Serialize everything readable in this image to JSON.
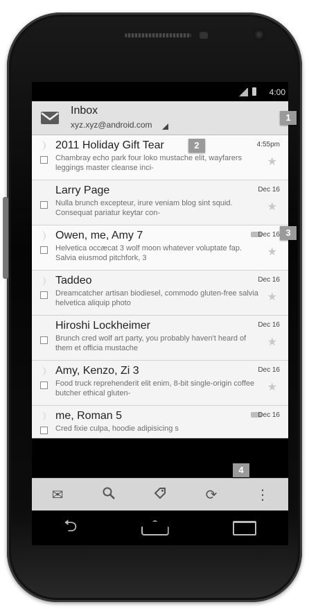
{
  "status_bar": {
    "time": "4:00"
  },
  "header": {
    "title": "Inbox",
    "account": "xyz.xyz@android.com"
  },
  "emails": [
    {
      "sender": "2011 Holiday Gift Tear",
      "date": "4:55pm",
      "snippet": "Chambray echo park four loko mustache elit, wayfarers leggings master cleanse inci-"
    },
    {
      "sender": "Larry Page",
      "date": "Dec 16",
      "snippet": "Nulla brunch excepteur, irure veniam blog sint squid. Consequat pariatur keytar con-"
    },
    {
      "sender": "Owen, me, Amy  7",
      "date": "Dec 16",
      "snippet": "Helvetica occæcat 3 wolf moon whatever voluptate fap. Salvia eiusmod pitchfork, 3"
    },
    {
      "sender": "Taddeo",
      "date": "Dec 16",
      "snippet": "Dreamcatcher artisan biodiesel, commodo gluten-free salvia helvetica aliquip photo"
    },
    {
      "sender": "Hiroshi Lockheimer",
      "date": "Dec 16",
      "snippet": "Brunch cred wolf art party, you probably haven't heard of them et officia mustache"
    },
    {
      "sender": "Amy, Kenzo, Zi  3",
      "date": "Dec 16",
      "snippet": "Food truck reprehenderit elit enim, 8-bit single-origin coffee butcher ethical gluten-"
    },
    {
      "sender": "me, Roman  5",
      "date": "Dec 16",
      "snippet": "Cred fixie culpa, hoodie adipisicing s"
    }
  ],
  "callouts": [
    "1",
    "2",
    "3",
    "4"
  ],
  "action_bar": [
    "compose-icon",
    "search-icon",
    "label-icon",
    "refresh-icon",
    "overflow-menu-icon"
  ],
  "nav_bar": [
    "back-icon",
    "home-icon",
    "recent-apps-icon"
  ]
}
